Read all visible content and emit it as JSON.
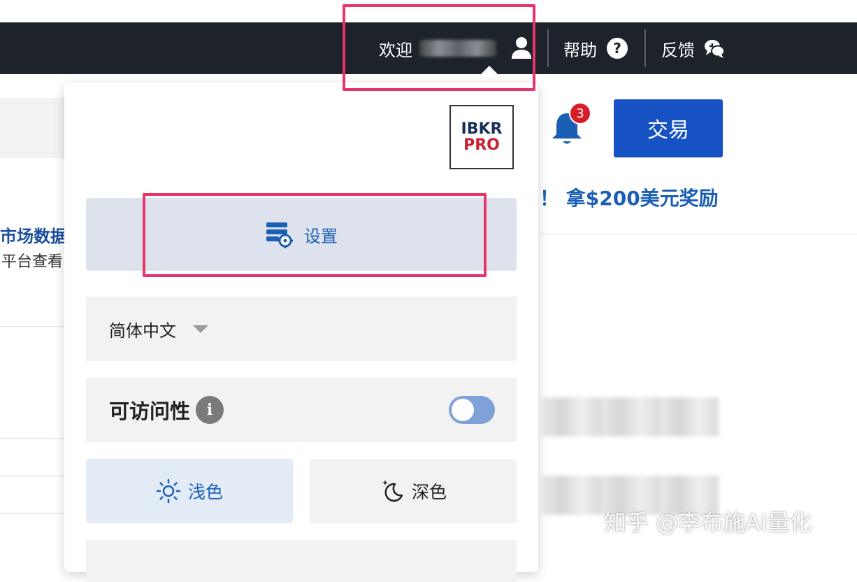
{
  "topbar": {
    "welcome_label": "欢迎",
    "user_icon": "user-icon",
    "help_label": "帮助",
    "help_icon": "question-circle-icon",
    "feedback_label": "反馈",
    "feedback_icon": "chat-bubbles-icon",
    "background_color": "#1e222b"
  },
  "page": {
    "background_text_1": "市场数据",
    "background_text_2": "平台查看",
    "notifications_count": "3",
    "trade_button_label": "交易",
    "promo_text": "！ 拿$200美元奖励",
    "accent_color": "#1652c4"
  },
  "menu": {
    "logo_line1": "IBKR",
    "logo_line2": "PRO",
    "settings_label": "设置",
    "settings_icon": "settings-gear-icon",
    "language_selected": "简体中文",
    "accessibility_label": "可访问性",
    "accessibility_enabled": false,
    "theme_light_label": "浅色",
    "theme_light_icon": "sun-icon",
    "theme_dark_label": "深色",
    "theme_dark_icon": "moon-icon",
    "selected_theme": "浅色"
  },
  "annotations": {
    "highlight_color": "#e8336b"
  },
  "watermark": "知乎 @李布施AI量化"
}
